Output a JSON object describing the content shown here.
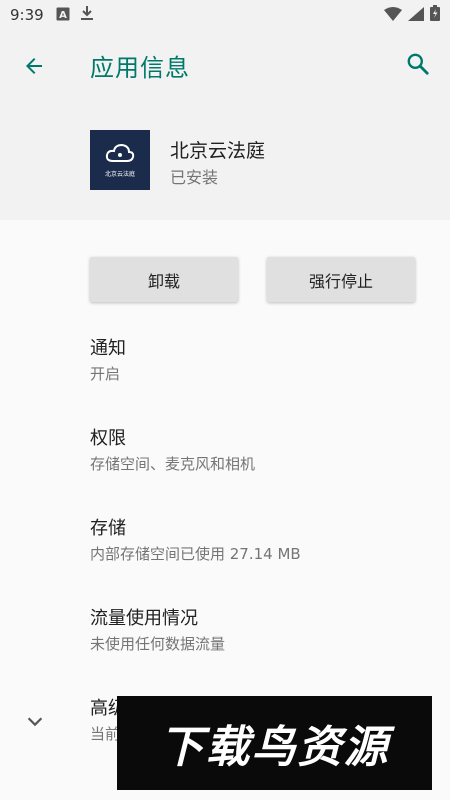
{
  "status_bar": {
    "time": "9:39",
    "left_icons": [
      "font-icon",
      "download-icon"
    ],
    "right_icons": [
      "wifi-icon",
      "signal-icon",
      "battery-icon"
    ]
  },
  "app_bar": {
    "title": "应用信息",
    "accent_color": "#00796b"
  },
  "app": {
    "name": "北京云法庭",
    "status": "已安装",
    "icon_label": "北京云法庭",
    "icon_bg": "#1a2b4c"
  },
  "buttons": {
    "uninstall": "卸载",
    "force_stop": "强行停止"
  },
  "settings": [
    {
      "title": "通知",
      "summary": "开启"
    },
    {
      "title": "权限",
      "summary": "存储空间、麦克风和相机"
    },
    {
      "title": "存储",
      "summary": "内部存储空间已使用 27.14 MB"
    },
    {
      "title": "流量使用情况",
      "summary": "未使用任何数据流量"
    },
    {
      "title": "高级",
      "summary": "当前"
    }
  ],
  "watermark": {
    "text": "下载鸟资源"
  }
}
